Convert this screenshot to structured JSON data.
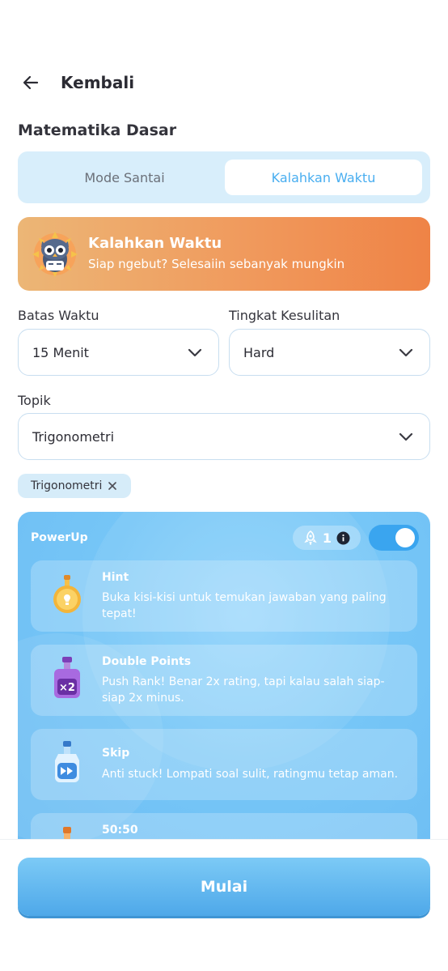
{
  "header": {
    "back_icon": "arrow-left-icon",
    "title": "Kembali"
  },
  "section_title": "Matematika Dasar",
  "mode_tabs": [
    {
      "label": "Mode Santai",
      "selected": false
    },
    {
      "label": "Kalahkan Waktu",
      "selected": true
    }
  ],
  "banner": {
    "title": "Kalahkan Waktu",
    "subtitle": "Siap ngebut? Selesaiin sebanyak mungkin",
    "mascot_icon": "owl-mascot-icon"
  },
  "time_limit": {
    "label": "Batas Waktu",
    "value": "15 Menit"
  },
  "difficulty": {
    "label": "Tingkat Kesulitan",
    "value": "Hard"
  },
  "topic": {
    "label": "Topik",
    "value": "Trigonometri"
  },
  "topic_chips": [
    {
      "label": "Trigonometri"
    }
  ],
  "powerup": {
    "title": "PowerUp",
    "count": "1",
    "enabled": true,
    "items": [
      {
        "name": "Hint",
        "description": "Buka kisi-kisi untuk temukan jawaban yang paling tepat!",
        "icon": "lightbulb-potion-icon"
      },
      {
        "name": "Double Points",
        "description": "Push Rank! Benar 2x rating, tapi kalau salah siap-siap 2x minus.",
        "icon": "x2-potion-icon"
      },
      {
        "name": "Skip",
        "description": "Anti stuck! Lompati soal sulit, ratingmu tetap aman.",
        "icon": "skip-potion-icon"
      },
      {
        "name": "50:50",
        "description": "",
        "icon": "fifty-fifty-potion-icon"
      }
    ]
  },
  "start_button": {
    "label": "Mulai"
  },
  "colors": {
    "accent": "#49aef0",
    "banner_start": "#ecb676",
    "banner_end": "#ef8346",
    "powerup_bg": "#76c6f7"
  }
}
